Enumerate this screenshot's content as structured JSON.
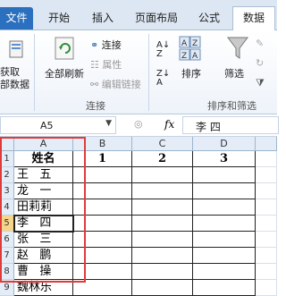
{
  "ribbon": {
    "tabs": [
      "文件",
      "开始",
      "插入",
      "页面布局",
      "公式",
      "数据"
    ],
    "active_tab": "数据",
    "get_data": [
      "获取",
      "部数据"
    ],
    "refresh_all": "全部刷新",
    "connections": "连接",
    "properties": "属性",
    "edit_links": "编辑链接",
    "group_connections": "连接",
    "sort": "排序",
    "filter": "筛选",
    "group_sort_filter": "排序和筛选"
  },
  "formula_bar": {
    "name_box": "A5",
    "fx": "fx",
    "content": "李  四"
  },
  "sheet": {
    "columns": [
      "A",
      "B",
      "C",
      "D"
    ],
    "row_numbers": [
      "1",
      "2",
      "3",
      "4",
      "5",
      "6",
      "7",
      "8",
      "9"
    ],
    "header_row": [
      "姓名",
      "1",
      "2",
      "3"
    ],
    "names": [
      "王   五",
      "龙   一",
      "田莉莉",
      "李   四",
      "张   三",
      "赵   鹏",
      "曹   操",
      "魏林乐"
    ],
    "selected_cell": "A5"
  }
}
